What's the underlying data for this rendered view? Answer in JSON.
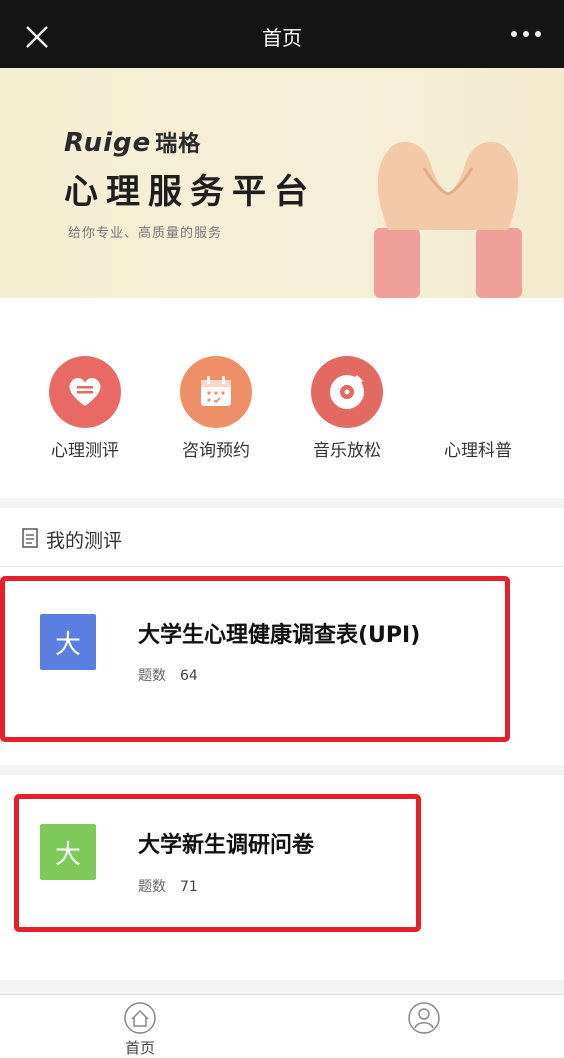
{
  "topbar": {
    "title": "首页"
  },
  "banner": {
    "brand_en": "Ruige",
    "brand_cn": "瑞格",
    "headline": "心理服务平台",
    "tagline": "给你专业、高质量的服务"
  },
  "services": [
    {
      "label": "心理测评",
      "icon": "heart-icon",
      "color": "#e96a64"
    },
    {
      "label": "咨询预约",
      "icon": "calendar-icon",
      "color": "#ee8f68"
    },
    {
      "label": "音乐放松",
      "icon": "music-disc-icon",
      "color": "#e36a62"
    },
    {
      "label": "心理科普",
      "icon": "",
      "color": ""
    }
  ],
  "section": {
    "title": "我的测评"
  },
  "assessments": [
    {
      "avatar": "大",
      "avatar_color": "#5b7fe0",
      "title": "大学生心理健康调查表(UPI)",
      "meta_label": "题数",
      "count": "64"
    },
    {
      "avatar": "大",
      "avatar_color": "#7dc95a",
      "title": "大学新生调研问卷",
      "meta_label": "题数",
      "count": "71"
    }
  ],
  "bottom_nav": [
    {
      "label": "首页",
      "icon": "home-icon"
    },
    {
      "label": "",
      "icon": "profile-icon"
    }
  ],
  "annotation_color": "#e5202a"
}
